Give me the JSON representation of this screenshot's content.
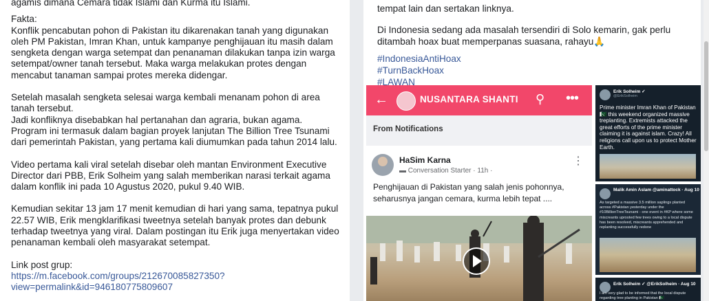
{
  "left_post": {
    "line_top": "agamis dimana Cemara tidak Islami dan Kurma itu Islami.",
    "fakta_label": "Fakta:",
    "para1": "Konflik pencabutan pohon di Pakistan itu dikarenakan tanah yang digunakan oleh PM Pakistan, Imran Khan, untuk kampanye penghijauan itu masih dalam sengketa dengan warga setempat dan penanaman dilakukan tanpa izin warga setempat/owner tanah tersebut. Maka warga melakukan protes dengan mencabut tanaman sampai protes mereka didengar.",
    "para2a": "Setelah masalah sengketa selesai warga kembali menanam pohon di area tanah tersebut.",
    "para2b": "Jadi konfliknya disebabkan hal pertanahan dan agraria, bukan agama. Program ini termasuk dalam bagian proyek lanjutan The Billion Tree Tsunami dari pemerintah Pakistan, yang pertama kali diumumkan pada tahun 2014 lalu.",
    "para3": "Video pertama kali viral setelah disebar oleh mantan Environment Executive Director dari PBB, Erik Solheim yang salah memberikan narasi terkait agama dalam konflik ini pada 10 Agustus 2020, pukul 9.40 WIB.",
    "para4": "Kemudian sekitar 13 jam 17 menit kemudian di hari yang sama, tepatnya pukul 22.57 WIB, Erik mengklarifikasi tweetnya setelah banyak protes dan debunk terhadap tweetnya yang viral. Dalam postingan itu Erik juga menyertakan video penanaman kembali oleh masyarakat setempat.",
    "link_label": "Link post grup:",
    "link_line1": "https://m.facebook.com/groups/212670085827350?",
    "link_line2": "view=permalink&id=946180775809607"
  },
  "right_post": {
    "line_top": "tempat lain dan sertakan linknya.",
    "para1": "Di Indonesia sedang ada masalah tersendiri di Solo kemarin, gak perlu ditambah hoax buat memperpanas suasana, rahayu🙏",
    "hashtags": [
      "#IndonesiaAntiHoax",
      "#TurnBackHoax",
      "#LAWAN"
    ]
  },
  "embedded": {
    "group_name": "NUSANTARA SHANTI",
    "section": "From Notifications",
    "author": "HaSim Karna",
    "meta": "▬ Conversation Starter · 11h ·",
    "post_text": "Penghijauan di Pakistan yang salah jenis pohonnya, seharusnya jangan cemara, kurma lebih tepat ....",
    "colors": {
      "topbar": "#f2476a",
      "tweet_bg": "#15202b"
    }
  },
  "tweets": [
    {
      "name": "Erik Solheim ✓",
      "handle": "@ErikSolheim",
      "text": "Prime minister Imran Khan of Pakistan 🇵🇰 this weekend organized massive treplanting. Extremists attacked the great efforts of the prime minister claiming it is against islam. Crazy! All religions call upon us to protect Mother Earth."
    },
    {
      "name": "Malik Amin Aslam @aminattock · Aug 10",
      "handle": "",
      "text": "As targeted a massive 3.5 million saplings planted across #Pakistan yesterday under the #10BillionTreeTsunami - one event in #KP where some miscreants uprooted few trees owing to a local dispute has been resolved, miscreants apprehended and replanting successfully redone"
    },
    {
      "name": "Erik Solheim ✓ @ErikSolheim · Aug 10",
      "handle": "",
      "text": "I am very glad to be informed that the local dispute regarding tree planting in Pakistan 🇵🇰"
    }
  ]
}
